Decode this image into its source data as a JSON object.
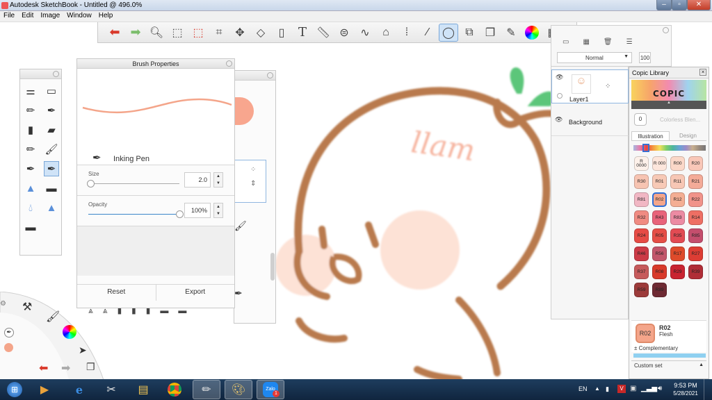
{
  "window": {
    "title": "Autodesk SketchBook - Untitled @ 496.0%"
  },
  "menu": [
    "File",
    "Edit",
    "Image",
    "Window",
    "Help"
  ],
  "brush_properties": {
    "title": "Brush Properties",
    "brush_name": "Inking Pen",
    "size_label": "Size",
    "size_value": "2.0",
    "size_fraction": 0.02,
    "opacity_label": "Opacity",
    "opacity_value": "100%",
    "opacity_fraction": 1.0,
    "reset_label": "Reset",
    "export_label": "Export"
  },
  "layers": {
    "blend_mode": "Normal",
    "opacity_value": "100",
    "items": [
      {
        "name": "Layer1",
        "selected": true
      },
      {
        "name": "Background",
        "selected": false
      }
    ]
  },
  "copic": {
    "title": "Copic Library",
    "logo": "COPIC",
    "colorless_code": "0",
    "colorless_name": "Colorless Blen...",
    "tabs": [
      "Illustration",
      "Design"
    ],
    "active_tab": "Illustration",
    "swatches": [
      {
        "code": "R 0000",
        "color": "#fdf1ea"
      },
      {
        "code": "R 000",
        "color": "#fde6dc"
      },
      {
        "code": "R00",
        "color": "#fbd8c8"
      },
      {
        "code": "R20",
        "color": "#f9c7b8"
      },
      {
        "code": "R30",
        "color": "#f7c4b2"
      },
      {
        "code": "R01",
        "color": "#f7c9b6"
      },
      {
        "code": "R11",
        "color": "#f7c7b5"
      },
      {
        "code": "R21",
        "color": "#f4ab98"
      },
      {
        "code": "R81",
        "color": "#f1b7c4"
      },
      {
        "code": "R02",
        "color": "#f4a58a"
      },
      {
        "code": "R12",
        "color": "#f4ae93"
      },
      {
        "code": "R22",
        "color": "#f1938a"
      },
      {
        "code": "R32",
        "color": "#f08b82"
      },
      {
        "code": "R43",
        "color": "#e8637a"
      },
      {
        "code": "R83",
        "color": "#ec8ba3"
      },
      {
        "code": "R14",
        "color": "#ee6f64"
      },
      {
        "code": "R24",
        "color": "#e64b45"
      },
      {
        "code": "R05",
        "color": "#e54e46"
      },
      {
        "code": "R35",
        "color": "#e24b53"
      },
      {
        "code": "R85",
        "color": "#c44e6d"
      },
      {
        "code": "R46",
        "color": "#cc3a46"
      },
      {
        "code": "R56",
        "color": "#c2566b"
      },
      {
        "code": "R17",
        "color": "#de4b2b"
      },
      {
        "code": "R27",
        "color": "#dd3d34"
      },
      {
        "code": "R37",
        "color": "#c65a5b"
      },
      {
        "code": "R08",
        "color": "#d83a2a"
      },
      {
        "code": "R29",
        "color": "#c92431"
      },
      {
        "code": "R39",
        "color": "#b02e37"
      },
      {
        "code": "R59",
        "color": "#9c3b3a"
      },
      {
        "code": "R89",
        "color": "#6e2a33"
      }
    ],
    "selected_code": "R02",
    "selected_name": "Flesh",
    "complementary_label": "Complementary",
    "custom_set_label": "Custom set"
  },
  "taskbar": {
    "language": "EN",
    "time": "9:53 PM",
    "date": "5/28/2021",
    "zalo_label": "Zalo",
    "zalo_badge": "1"
  },
  "canvas_text": "llam"
}
